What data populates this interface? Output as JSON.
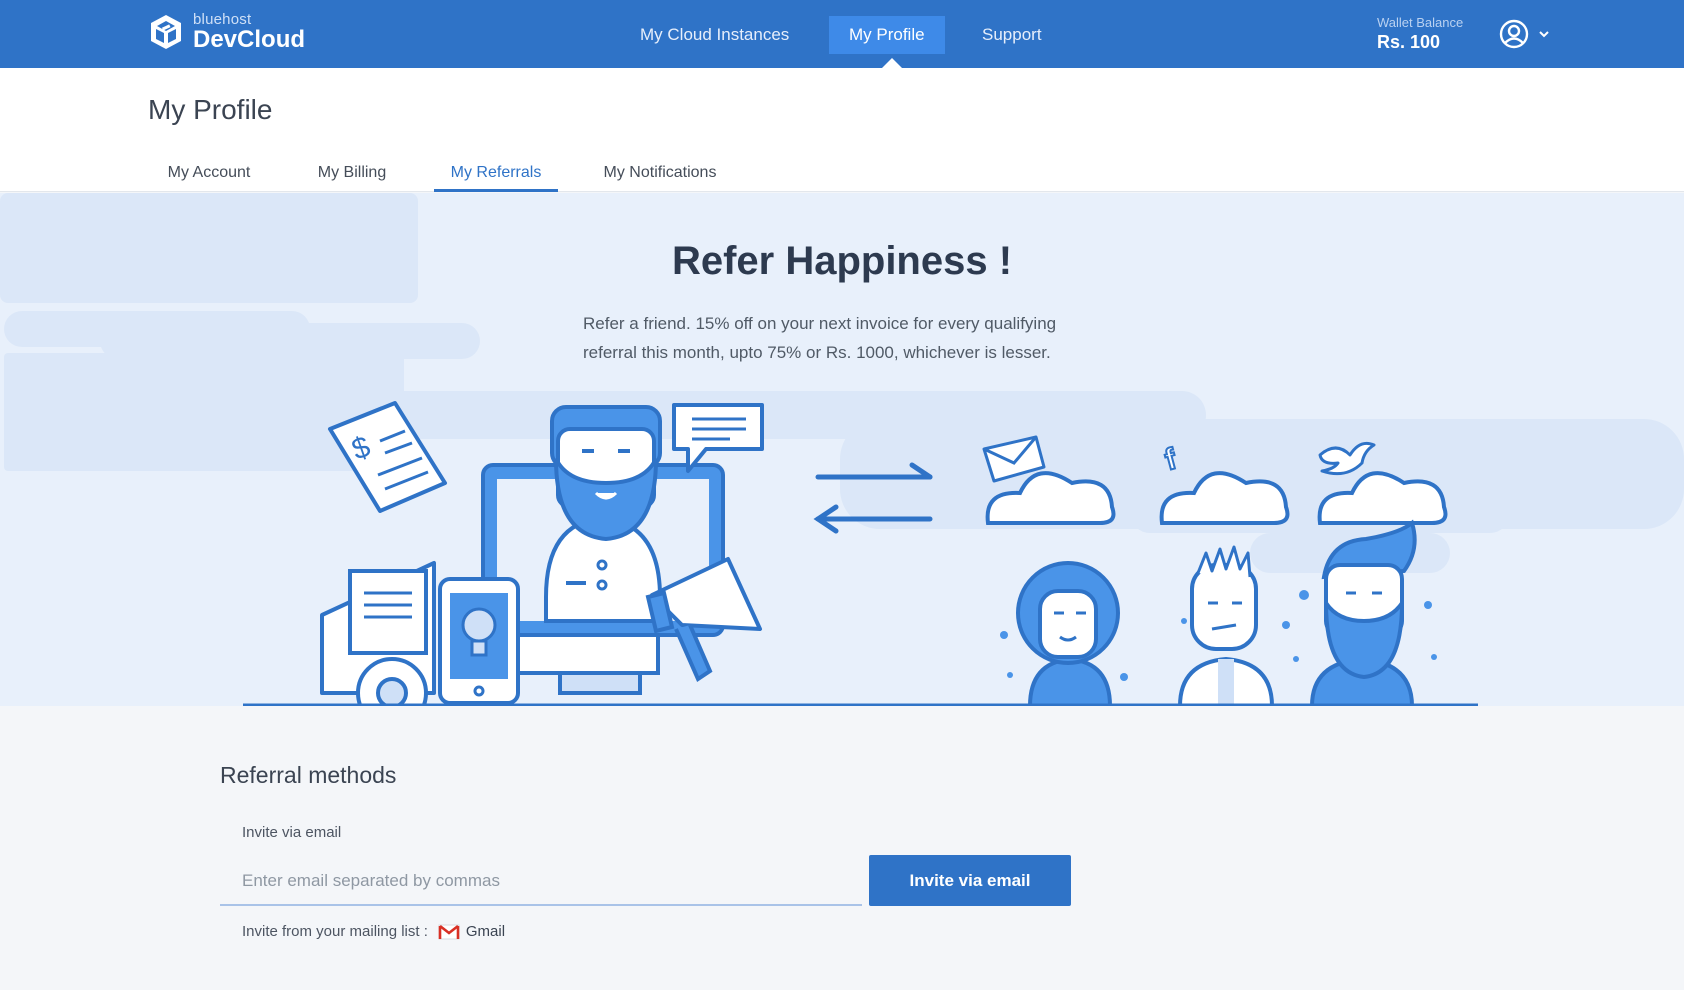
{
  "brand": {
    "sub": "bluehost",
    "name": "DevCloud"
  },
  "nav": {
    "items": [
      {
        "label": "My Cloud Instances"
      },
      {
        "label": "My Profile"
      },
      {
        "label": "Support"
      }
    ]
  },
  "wallet": {
    "label": "Wallet Balance",
    "value": "Rs. 100"
  },
  "page": {
    "title": "My Profile",
    "tabs": [
      {
        "label": "My Account"
      },
      {
        "label": "My Billing"
      },
      {
        "label": "My Referrals"
      },
      {
        "label": "My Notifications"
      }
    ]
  },
  "hero": {
    "title": "Refer Happiness !",
    "desc": "Refer a friend. 15% off on your next invoice for every qualifying referral this month, upto 75% or Rs. 1000, whichever is lesser."
  },
  "referral": {
    "section_title": "Referral methods",
    "email_label": "Invite via email",
    "email_placeholder": "Enter email separated by commas",
    "invite_button": "Invite via email",
    "mailing_label": "Invite from your mailing list :",
    "gmail_label": "Gmail"
  },
  "colors": {
    "primary": "#2f73c7",
    "accent": "#3e8ae8",
    "hero_bg": "#e8f0fb"
  }
}
